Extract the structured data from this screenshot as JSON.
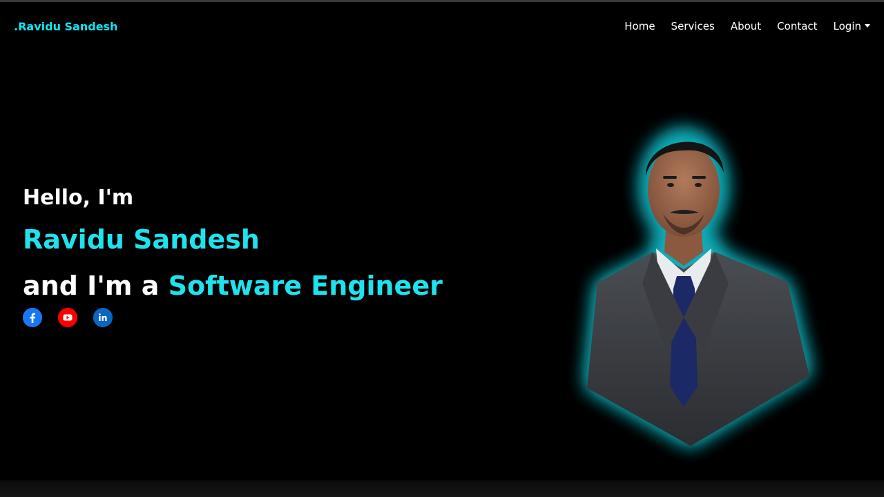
{
  "navbar": {
    "brand": ".Ravidu Sandesh",
    "links": [
      "Home",
      "Services",
      "About",
      "Contact"
    ],
    "login_label": "Login"
  },
  "hero": {
    "greeting": "Hello, I'm",
    "name": "Ravidu Sandesh",
    "role_prefix": "and I'm a",
    "role": "Software Engineer"
  },
  "socials": [
    {
      "icon": "facebook-icon",
      "color": "#1877f2"
    },
    {
      "icon": "youtube-icon",
      "color": "#ff0000"
    },
    {
      "icon": "linkedin-icon",
      "color": "#0a66c2"
    }
  ],
  "colors": {
    "accent": "#1ee3ef",
    "background": "#000000"
  }
}
